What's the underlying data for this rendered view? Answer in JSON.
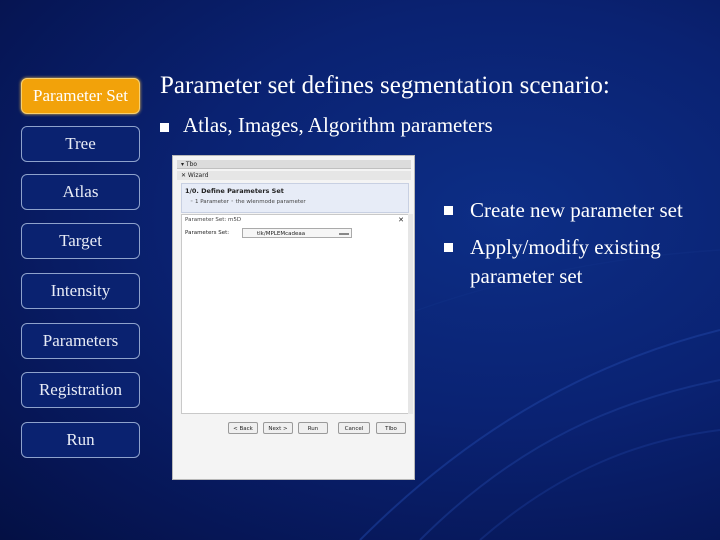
{
  "nav": {
    "items": [
      {
        "label": "Parameter Set",
        "active": true
      },
      {
        "label": "Tree",
        "active": false
      },
      {
        "label": "Atlas",
        "active": false
      },
      {
        "label": "Target",
        "active": false
      },
      {
        "label": "Intensity",
        "active": false
      },
      {
        "label": "Parameters",
        "active": false
      },
      {
        "label": "Registration",
        "active": false
      },
      {
        "label": "Run",
        "active": false
      }
    ]
  },
  "slide": {
    "title": "Parameter set defines segmentation scenario:",
    "subtitle": "Atlas, Images, Algorithm parameters",
    "bullets": [
      "Create new parameter set",
      "Apply/modify existing parameter set"
    ]
  },
  "screenshot": {
    "bar1": "▾ Tbo",
    "bar2": "✕ Wizard",
    "step_title": "1/0. Define Parameters Set",
    "step_line": "◦  1 Parameter  ◦  the wlenmode parameter",
    "pane_head": "Parameter Set: m5D",
    "pane_close": "✕",
    "field_label": "Parameters Set:",
    "field_value": "tlk/MPLEMcadeaa",
    "buttons": [
      "< Back",
      "Next >",
      "Run",
      "Cancel",
      "Tlbo"
    ]
  },
  "colors": {
    "background": "#0a2272",
    "active_nav": "#f2a20a",
    "nav_border": "#8ea2cc"
  }
}
